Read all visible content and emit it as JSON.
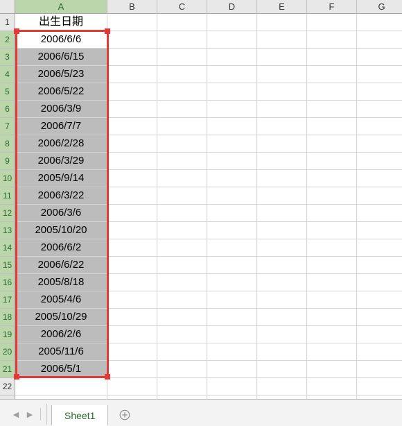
{
  "columns": [
    "A",
    "B",
    "C",
    "D",
    "E",
    "F",
    "G"
  ],
  "active_column": "A",
  "row_count": 23,
  "selected_rows_from": 2,
  "selected_rows_to": 21,
  "header_row": 1,
  "header_label": "出生日期",
  "active_cell_row": 2,
  "cellsA": [
    "2006/6/6",
    "2006/6/15",
    "2006/5/23",
    "2006/5/22",
    "2006/3/9",
    "2006/7/7",
    "2006/2/28",
    "2006/3/29",
    "2005/9/14",
    "2006/3/22",
    "2006/3/6",
    "2005/10/20",
    "2006/6/2",
    "2006/6/22",
    "2005/8/18",
    "2005/4/6",
    "2005/10/29",
    "2006/2/6",
    "2005/11/6",
    "2006/5/1"
  ],
  "sheet": {
    "active_tab": "Sheet1"
  },
  "chart_data": {
    "type": "table",
    "title": "出生日期",
    "columns": [
      "出生日期"
    ],
    "rows": [
      [
        "2006/6/6"
      ],
      [
        "2006/6/15"
      ],
      [
        "2006/5/23"
      ],
      [
        "2006/5/22"
      ],
      [
        "2006/3/9"
      ],
      [
        "2006/7/7"
      ],
      [
        "2006/2/28"
      ],
      [
        "2006/3/29"
      ],
      [
        "2005/9/14"
      ],
      [
        "2006/3/22"
      ],
      [
        "2006/3/6"
      ],
      [
        "2005/10/20"
      ],
      [
        "2006/6/2"
      ],
      [
        "2006/6/22"
      ],
      [
        "2005/8/18"
      ],
      [
        "2005/4/6"
      ],
      [
        "2005/10/29"
      ],
      [
        "2006/2/6"
      ],
      [
        "2005/11/6"
      ],
      [
        "2006/5/1"
      ]
    ]
  }
}
